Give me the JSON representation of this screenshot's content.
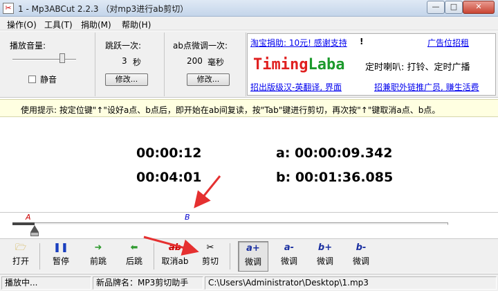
{
  "window": {
    "title": "1 - Mp3ABCut 2.2.3 （对mp3进行ab剪切）",
    "minimize_glyph": "—",
    "maximize_glyph": "□",
    "close_glyph": "✕"
  },
  "menu": [
    "操作(O)",
    "工具(T)",
    "捐助(M)",
    "帮助(H)"
  ],
  "volume": {
    "label": "播放音量:",
    "mute_label": "静音",
    "level": 0.78
  },
  "jump": {
    "label": "跳跃一次:",
    "value": "3",
    "unit": "秒",
    "button": "修改..."
  },
  "fine_tune": {
    "label": "ab点微调一次:",
    "value": "200",
    "unit": "毫秒",
    "button": "修改..."
  },
  "ad": {
    "donate_link": "淘宝捐助: 10元! 感谢支持",
    "donate_mark": "!",
    "ad_link": "广告位招租",
    "brand_part1": "Timing",
    "brand_part2": "Laba",
    "brand_desc": "定时喇叭: 打铃、定时广播",
    "recruit_link": "招出版级汉-英翻译, 界面",
    "promo_link": "招兼职外链推广员, 赚生活费"
  },
  "tip": "使用提示: 按定位键\"↑\"设好a点、b点后，即开始在ab间复读，按\"Tab\"键进行剪切，再次按\"↑\"键取消a点、b点。",
  "display": {
    "current_time": "00:00:12",
    "total_time": "00:04:01",
    "a_label": "a: 00:00:09.342",
    "b_label": "b: 00:01:36.085"
  },
  "timeline": {
    "marker_a": "A",
    "marker_b": "B",
    "position": 0.05
  },
  "toolbar": {
    "open": "打开",
    "pause": "暂停",
    "forward": "前跳",
    "back": "后跳",
    "cancel_ab": "取消ab",
    "cancel_icon": "ab",
    "cut": "剪切",
    "a_plus_icon": "a+",
    "a_plus": "微调",
    "a_minus_icon": "a-",
    "a_minus": "微调",
    "b_plus_icon": "b+",
    "b_plus": "微调",
    "b_minus_icon": "b-",
    "b_minus": "微调"
  },
  "status": {
    "state": "播放中...",
    "product": "新品牌名：MP3剪切助手",
    "file": "C:\\Users\\Administrator\\Desktop\\1.mp3"
  },
  "colors": {
    "brand_red": "#e02020",
    "brand_green": "#1c9a2c",
    "annotation_arrow": "#e53030",
    "tip_background": "#ffffe1"
  }
}
